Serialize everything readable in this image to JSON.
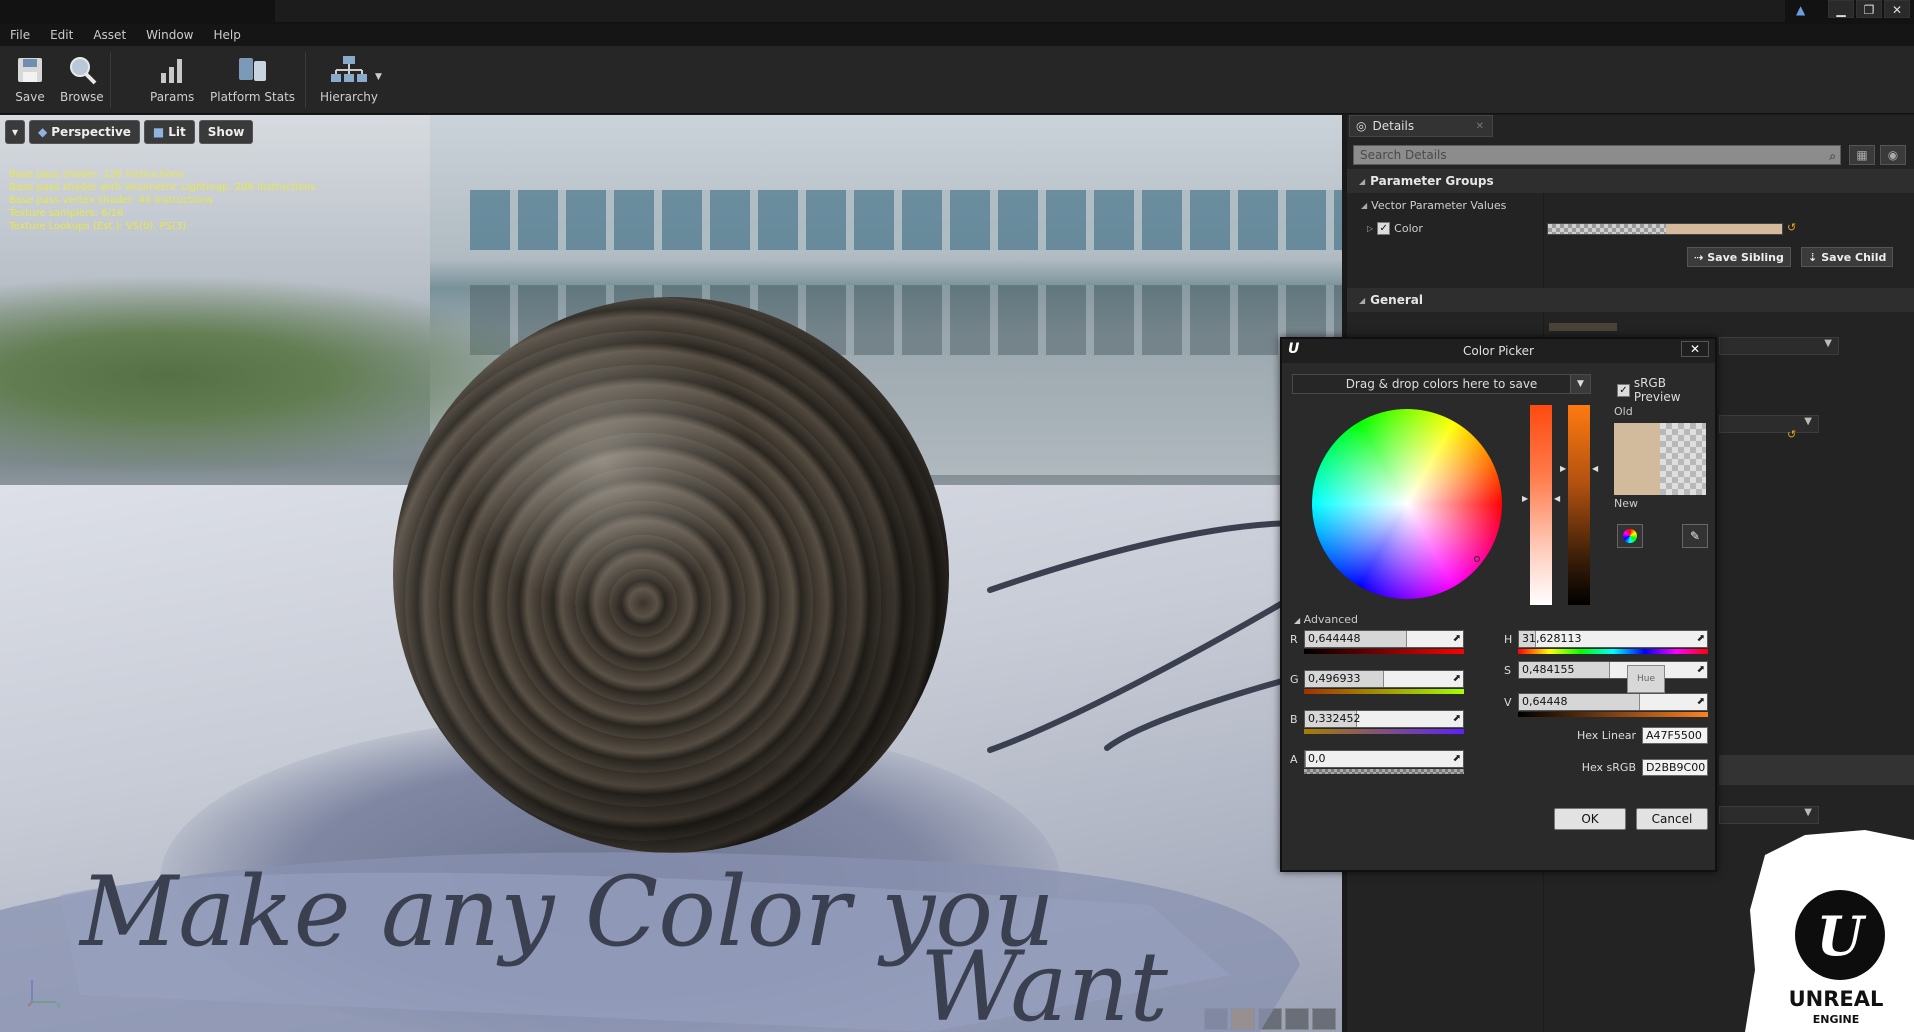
{
  "titlebar": {
    "controls": [
      "▁",
      "❐",
      "✕"
    ]
  },
  "menu": [
    "File",
    "Edit",
    "Asset",
    "Window",
    "Help"
  ],
  "toolbar": {
    "save": "Save",
    "browse": "Browse",
    "params": "Params",
    "platform_stats": "Platform Stats",
    "hierarchy": "Hierarchy"
  },
  "viewport": {
    "perspective": "Perspective",
    "lit": "Lit",
    "show": "Show",
    "stats": [
      "Base pass shader: 128 instructions",
      "Base pass shader with Volumetric Lightmap: 206 instructions",
      "Base pass vertex shader: 44 instructions",
      "Texture samplers: 6/16",
      "Texture Lookups (Est.): VS(0), PS(3)"
    ],
    "axis_y": "Y"
  },
  "details": {
    "tab": "Details",
    "search_placeholder": "Search Details",
    "parameter_groups": "Parameter Groups",
    "vector_parameter_values": "Vector Parameter Values",
    "color_label": "Color",
    "save_sibling": "Save Sibling",
    "save_child": "Save Child",
    "general": "General",
    "swatch_color": "#d6ba9c"
  },
  "picker": {
    "title": "Color Picker",
    "drag_drop": "Drag & drop colors here to save",
    "srgb_preview": "sRGB Preview",
    "old": "Old",
    "new": "New",
    "advanced": "Advanced",
    "R": {
      "label": "R",
      "value": "0,644448",
      "fill": 0.644
    },
    "G": {
      "label": "G",
      "value": "0,496933",
      "fill": 0.497
    },
    "B": {
      "label": "B",
      "value": "0,332452",
      "fill": 0.332
    },
    "A": {
      "label": "A",
      "value": "0,0",
      "fill": 0.0
    },
    "H": {
      "label": "H",
      "value": "31,628113",
      "fill": 0.088
    },
    "S": {
      "label": "S",
      "value": "0,484155",
      "fill": 0.484
    },
    "V": {
      "label": "V",
      "value": "0,64448",
      "fill": 0.644
    },
    "hue_tooltip": "Hue",
    "hex_linear_label": "Hex Linear",
    "hex_linear": "A47F5500",
    "hex_srgb_label": "Hex sRGB",
    "hex_srgb": "D2BB9C00",
    "ok": "OK",
    "cancel": "Cancel",
    "old_color": "#d2bb9c"
  },
  "logo": {
    "line1": "UNREAL",
    "line2": "ENGINE"
  },
  "handwriting": {
    "line1": "Make any Color you",
    "line2": "Want"
  }
}
